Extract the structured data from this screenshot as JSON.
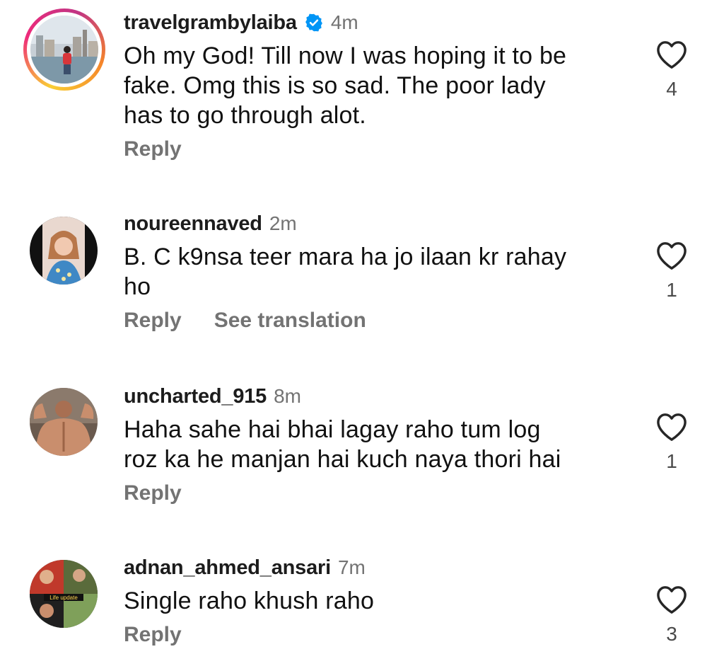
{
  "comments": [
    {
      "username": "travelgrambylaiba",
      "verified": true,
      "time": "4m",
      "lines": [
        "Oh my God! Till now I was hoping it to be",
        "fake. Omg this is so sad. The poor lady",
        "has to go through alot."
      ],
      "reply": "Reply",
      "likes": "4"
    },
    {
      "username": "noureennaved",
      "verified": false,
      "time": "2m",
      "lines": [
        "B. C k9nsa teer mara ha jo ilaan kr rahay",
        "ho"
      ],
      "reply": "Reply",
      "see_translation": "See translation",
      "likes": "1"
    },
    {
      "username": "uncharted_915",
      "verified": false,
      "time": "8m",
      "lines": [
        "Haha sahe hai bhai lagay raho tum log",
        "roz ka he manjan hai kuch naya thori hai"
      ],
      "reply": "Reply",
      "likes": "1"
    },
    {
      "username": "adnan_ahmed_ansari",
      "verified": false,
      "time": "7m",
      "lines": [
        "Single raho khush raho"
      ],
      "reply": "Reply",
      "likes": "3",
      "avatar_text": "Life update"
    }
  ],
  "icons": {
    "like": "heart-outline-icon",
    "verified": "verified-badge-icon"
  },
  "colors": {
    "verified": "#0095f6",
    "secondary_text": "#737373",
    "story_ring": [
      "#f9ce34",
      "#ee2a7b",
      "#c13584"
    ]
  }
}
